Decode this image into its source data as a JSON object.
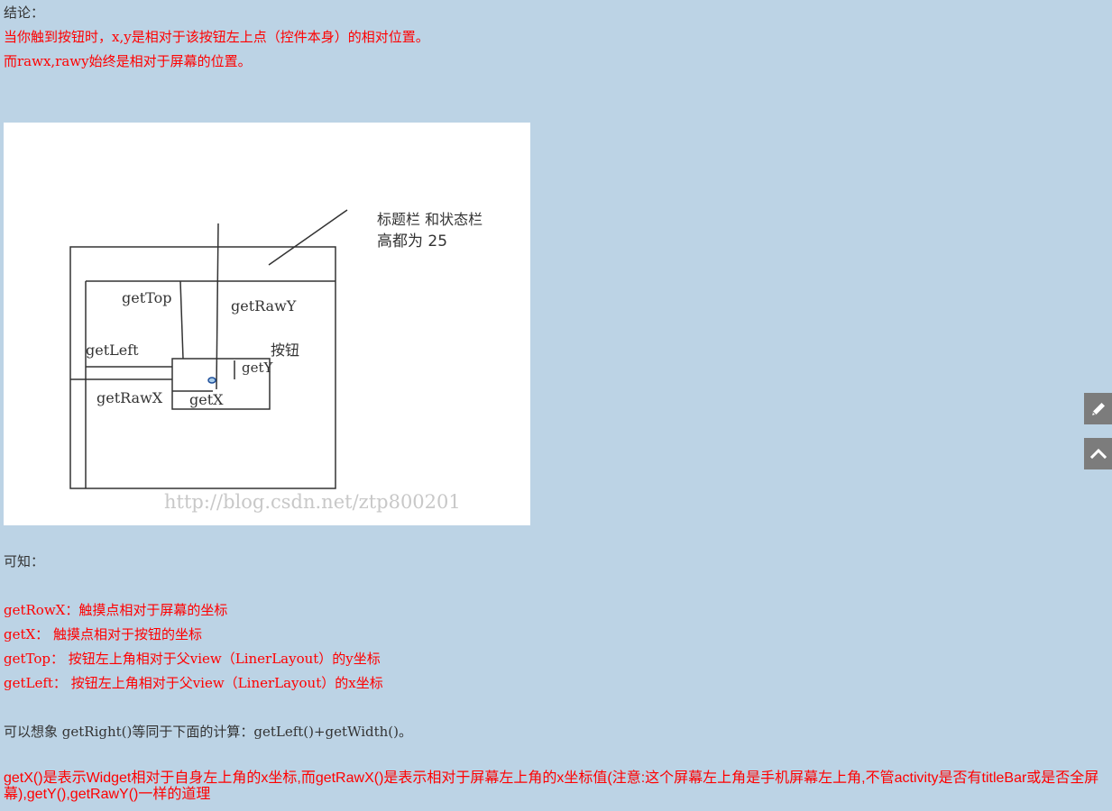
{
  "conclusion": {
    "heading": "结论：",
    "line1": "当你触到按钮时，x,y是相对于该按钮左上点（控件本身）的相对位置。",
    "line2": "而rawx,rawy始终是相对于屏幕的位置。"
  },
  "figure": {
    "status_note_line1": "标题栏 和状态栏",
    "status_note_line2": "高都为 25",
    "label_get_top": "getTop",
    "label_get_raw_y": "getRawY",
    "label_get_left": "getLeft",
    "label_button": "按钮",
    "label_get_y": "getY",
    "label_get_raw_x": "getRawX",
    "label_get_x": "getX",
    "watermark": "http://blog.csdn.net/ztp800201"
  },
  "summary": {
    "heading": "可知：",
    "items": [
      "getRowX：触摸点相对于屏幕的坐标",
      "getX： 触摸点相对于按钮的坐标",
      "getTop： 按钮左上角相对于父view（LinerLayout）的y坐标",
      "getLeft： 按钮左上角相对于父view（LinerLayout）的x坐标"
    ],
    "get_right_note": "可以想象 getRight()等同于下面的计算：getLeft()+getWidth()。",
    "final_note": "getX()是表示Widget相对于自身左上角的x坐标,而getRawX()是表示相对于屏幕左上角的x坐标值(注意:这个屏幕左上角是手机屏幕左上角,不管activity是否有titleBar或是否全屏幕),getY(),getRawY()一样的道理"
  },
  "side_tools": {
    "edit_icon": "pencil-icon",
    "top_icon": "chevron-up-icon"
  },
  "colors": {
    "background": "#bcd3e5",
    "highlight_text": "#ff0000",
    "body_text": "#333333",
    "side_button": "#7c7c7c"
  }
}
